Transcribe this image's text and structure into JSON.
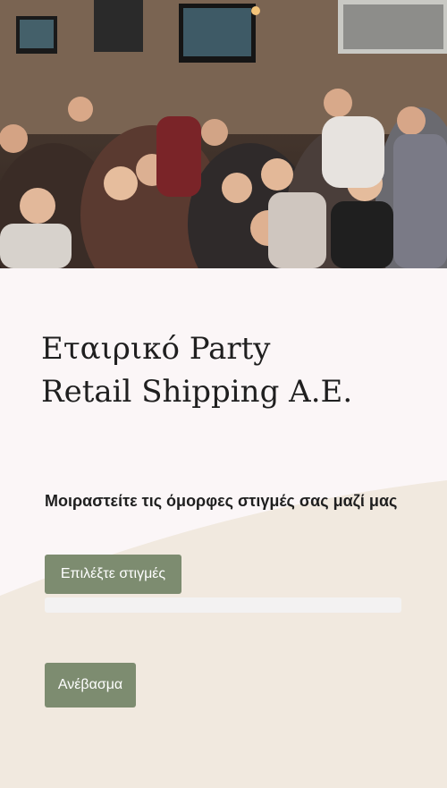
{
  "hero": {
    "image": "event-party-photo"
  },
  "heading": {
    "line1": "Εταιρικό Party",
    "line2": "Retail Shipping A.E."
  },
  "upload": {
    "prompt": "Μοιραστείτε τις όμορφες στιγμές σας μαζί μας",
    "select_label": "Επιλέξτε στιγμές",
    "progress_fraction": 0,
    "upload_label": "Ανέβασμα"
  },
  "colors": {
    "background": "#fbf6f7",
    "wave": "#f1e9df",
    "button": "#7d8c70",
    "progress_track": "#f3f2f2",
    "text": "#1f1f1f"
  }
}
